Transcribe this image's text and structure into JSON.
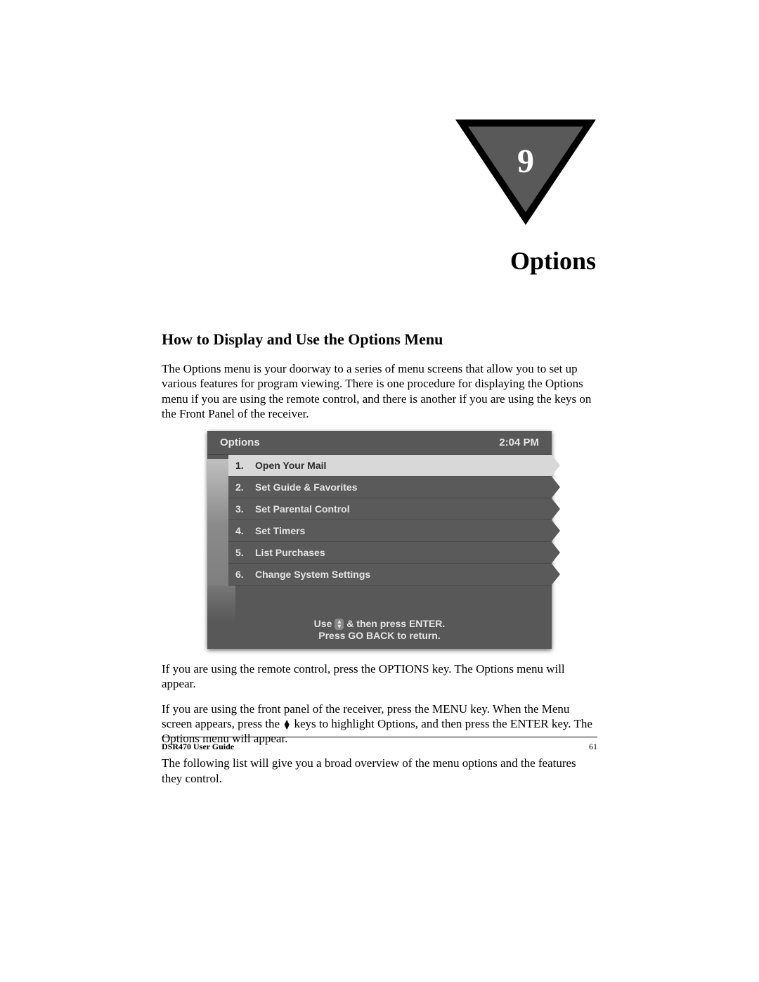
{
  "chapter": {
    "number": "9",
    "title": "Options"
  },
  "section": {
    "heading": "How to Display and Use the Options Menu",
    "para1": "The Options menu is your doorway to a series of menu screens that allow you to set up various features for program viewing. There is one procedure for displaying the Options menu if you are using the remote control, and there is another if you are using the keys on the Front Panel of the receiver.",
    "para2": "If you are using the remote control, press the OPTIONS key. The Options menu will appear.",
    "para3_a": "If you are using the front panel of the receiver, press the MENU key. When the Menu screen appears, press the ",
    "para3_b": " keys to highlight Options, and then press the ENTER key. The Options menu will appear.",
    "para4": "The following list will give you a broad overview of the menu options and the features they control."
  },
  "screenshot": {
    "header_title": "Options",
    "header_time": "2:04 PM",
    "items": [
      {
        "num": "1.",
        "label": "Open Your Mail",
        "selected": true
      },
      {
        "num": "2.",
        "label": "Set Guide & Favorites",
        "selected": false
      },
      {
        "num": "3.",
        "label": "Set Parental Control",
        "selected": false
      },
      {
        "num": "4.",
        "label": "Set Timers",
        "selected": false
      },
      {
        "num": "5.",
        "label": "List Purchases",
        "selected": false
      },
      {
        "num": "6.",
        "label": "Change System Settings",
        "selected": false
      }
    ],
    "footer_line1_a": "Use",
    "footer_line1_b": "& then press ENTER.",
    "footer_line2": "Press GO BACK to return."
  },
  "footer": {
    "guide": "DSR470 User Guide",
    "page": "61"
  }
}
